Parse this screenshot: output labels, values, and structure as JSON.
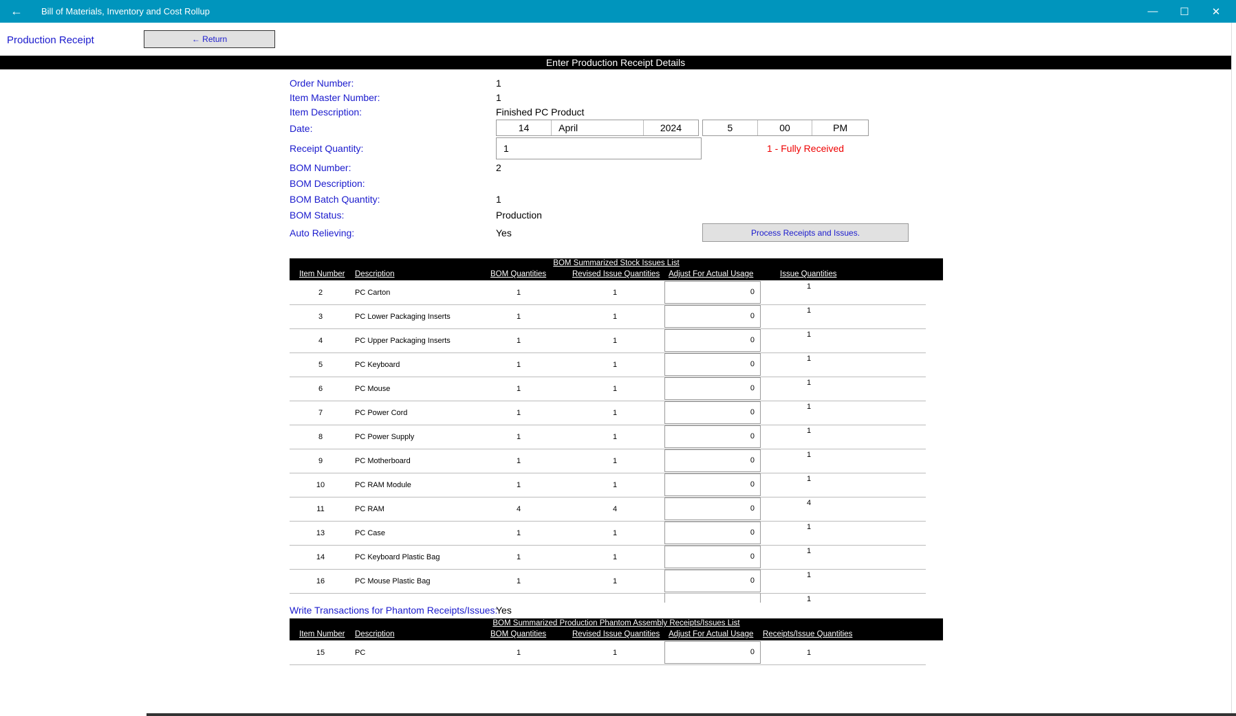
{
  "titlebar": {
    "title": "Bill of Materials, Inventory and Cost Rollup",
    "back_glyph": "←",
    "minimize": "—",
    "maximize": "☐",
    "close": "✕"
  },
  "header": {
    "page_title": "Production Receipt",
    "return_label": "← Return"
  },
  "banner": "Enter Production Receipt Details",
  "fields": {
    "order_number_label": "Order Number:",
    "order_number": "1",
    "item_master_label": "Item Master Number:",
    "item_master": "1",
    "item_desc_label": "Item Description:",
    "item_desc": "Finished PC Product",
    "date_label": "Date:",
    "date": {
      "day": "14",
      "month": "April",
      "year": "2024",
      "hour": "5",
      "minute": "00",
      "ampm": "PM"
    },
    "receipt_qty_label": "Receipt Quantity:",
    "receipt_qty": "1",
    "received_status": "1  - Fully Received",
    "bom_number_label": "BOM Number:",
    "bom_number": "2",
    "bom_desc_label": "BOM Description:",
    "bom_desc": "",
    "bom_batch_label": "BOM Batch Quantity:",
    "bom_batch": "1",
    "bom_status_label": "BOM Status:",
    "bom_status": "Production",
    "auto_relieving_label": "Auto Relieving:",
    "auto_relieving": "Yes",
    "process_button": "Process Receipts and Issues."
  },
  "issues_table": {
    "title": "BOM Summarized Stock Issues List",
    "headers": {
      "item": "Item Number",
      "desc": "Description",
      "bom": "BOM Quantities",
      "revised": "Revised Issue Quantities",
      "adjust": "Adjust For Actual Usage",
      "issue": "Issue Quantities"
    },
    "rows": [
      {
        "item": "2",
        "desc": "PC Carton",
        "bom": "1",
        "revised": "1",
        "adjust": "0",
        "issue": "1"
      },
      {
        "item": "3",
        "desc": "PC Lower Packaging Inserts",
        "bom": "1",
        "revised": "1",
        "adjust": "0",
        "issue": "1"
      },
      {
        "item": "4",
        "desc": "PC Upper Packaging Inserts",
        "bom": "1",
        "revised": "1",
        "adjust": "0",
        "issue": "1"
      },
      {
        "item": "5",
        "desc": "PC Keyboard",
        "bom": "1",
        "revised": "1",
        "adjust": "0",
        "issue": "1"
      },
      {
        "item": "6",
        "desc": "PC Mouse",
        "bom": "1",
        "revised": "1",
        "adjust": "0",
        "issue": "1"
      },
      {
        "item": "7",
        "desc": "PC Power Cord",
        "bom": "1",
        "revised": "1",
        "adjust": "0",
        "issue": "1"
      },
      {
        "item": "8",
        "desc": "PC Power Supply",
        "bom": "1",
        "revised": "1",
        "adjust": "0",
        "issue": "1"
      },
      {
        "item": "9",
        "desc": "PC Motherboard",
        "bom": "1",
        "revised": "1",
        "adjust": "0",
        "issue": "1"
      },
      {
        "item": "10",
        "desc": "PC RAM Module",
        "bom": "1",
        "revised": "1",
        "adjust": "0",
        "issue": "1"
      },
      {
        "item": "11",
        "desc": "PC RAM",
        "bom": "4",
        "revised": "4",
        "adjust": "0",
        "issue": "4"
      },
      {
        "item": "13",
        "desc": "PC Case",
        "bom": "1",
        "revised": "1",
        "adjust": "0",
        "issue": "1"
      },
      {
        "item": "14",
        "desc": "PC Keyboard Plastic Bag",
        "bom": "1",
        "revised": "1",
        "adjust": "0",
        "issue": "1"
      },
      {
        "item": "16",
        "desc": "PC Mouse Plastic Bag",
        "bom": "1",
        "revised": "1",
        "adjust": "0",
        "issue": "1"
      }
    ],
    "partial_issue": "1"
  },
  "phantom": {
    "label": "Write Transactions for Phantom Receipts/Issues:",
    "value": "Yes"
  },
  "phantom_table": {
    "title": "BOM Summarized Production Phantom Assembly Receipts/Issues List",
    "headers": {
      "item": "Item Number",
      "desc": "Description",
      "bom": "BOM Quantities",
      "revised": "Revised Issue Quantities",
      "adjust": "Adjust For Actual Usage",
      "issue": "Receipts/Issue Quantities"
    },
    "rows": [
      {
        "item": "15",
        "desc": "PC",
        "bom": "1",
        "revised": "1",
        "adjust": "0",
        "issue": "1"
      }
    ]
  }
}
